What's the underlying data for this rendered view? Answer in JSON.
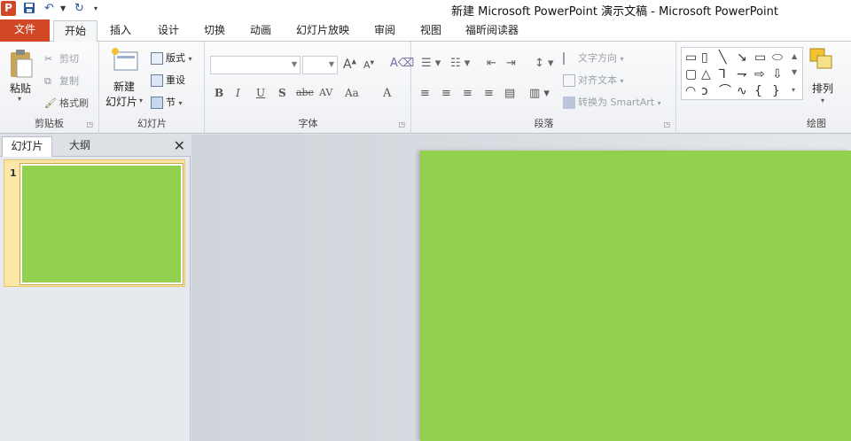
{
  "titlebar": {
    "app_icon": "P",
    "title": "新建 Microsoft PowerPoint 演示文稿 - Microsoft PowerPoint"
  },
  "tabs": {
    "file": "文件",
    "home": "开始",
    "insert": "插入",
    "design": "设计",
    "transitions": "切换",
    "animations": "动画",
    "slideshow": "幻灯片放映",
    "review": "审阅",
    "view": "视图",
    "foxit": "福昕阅读器"
  },
  "clipboard": {
    "label": "剪贴板",
    "paste": "粘贴",
    "cut": "剪切",
    "copy": "复制",
    "format_painter": "格式刷"
  },
  "slides_group": {
    "label": "幻灯片",
    "new_slide_line1": "新建",
    "new_slide_line2": "幻灯片",
    "layout": "版式",
    "reset": "重设",
    "section": "节"
  },
  "font": {
    "label": "字体",
    "font_name": "",
    "font_size": "",
    "bold": "B",
    "italic": "I",
    "underline": "U",
    "shadow": "S",
    "strike": "abc",
    "spacing": "AV",
    "case": "Aa",
    "color": "A"
  },
  "paragraph": {
    "label": "段落",
    "text_direction": "文字方向",
    "align_text": "对齐文本",
    "smartart": "转换为 SmartArt"
  },
  "drawing": {
    "label": "绘图",
    "arrange": "排列"
  },
  "pane": {
    "slides_tab": "幻灯片",
    "outline_tab": "大纲",
    "close": "✕",
    "thumb_number": "1"
  },
  "colors": {
    "slide_fill": "#92d050",
    "file_tab": "#d24726"
  }
}
